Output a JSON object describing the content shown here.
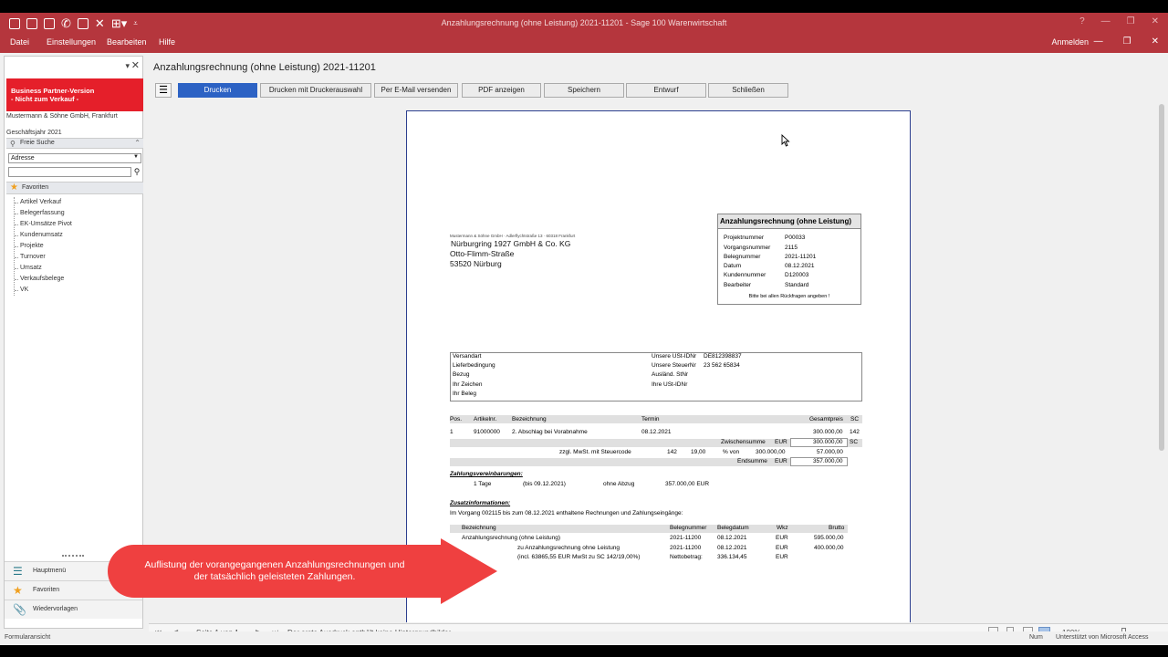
{
  "window": {
    "title": "Anzahlungsrechnung (ohne Leistung) 2021-11201 - Sage 100 Warenwirtschaft",
    "help": "?",
    "colors": {
      "titlebar": "#b5363d",
      "primary_button": "#2c62c4",
      "banner": "#e51f2a",
      "callout": "#ef4040"
    }
  },
  "menu": {
    "items": [
      "Datei",
      "Einstellungen",
      "Bearbeiten",
      "Hilfe"
    ],
    "login": "Anmelden"
  },
  "sidebar": {
    "banner_line1": "Business Partner-Version",
    "banner_line2": "- Nicht zum Verkauf -",
    "company": "Mustermann & Söhne GmbH, Frankfurt",
    "fiscal_year": "Geschäftsjahr 2021",
    "search_label": "Freie Suche",
    "search_select": "Adresse",
    "favorites_label": "Favoriten",
    "tree": [
      "Artikel Verkauf",
      "Belegerfassung",
      "EK-Umsätze Pivot",
      "Kundenumsatz",
      "Projekte",
      "Turnover",
      "Umsatz",
      "Verkaufsbelege",
      "VK"
    ],
    "nav": [
      "Hauptmenü",
      "Favoriten",
      "Wiedervorlagen"
    ]
  },
  "main": {
    "title": "Anzahlungsrechnung (ohne Leistung) 2021-11201",
    "toolbar": [
      "Drucken",
      "Drucken mit Druckerauswahl",
      "Per E-Mail versenden",
      "PDF anzeigen",
      "Speichern",
      "Entwurf",
      "Schließen"
    ]
  },
  "document": {
    "sender_line": "Mustermann & Söhne GmbH · Adlerflychtstraße 13 · 60318 Frankfurt",
    "address": [
      "Nürburgring 1927 GmbH & Co. KG",
      "Otto-Flimm-Straße",
      "53520 Nürburg"
    ],
    "info_title": "Anzahlungsrechnung (ohne Leistung)",
    "info_rows": [
      {
        "label": "Projektnummer",
        "value": "P00033"
      },
      {
        "label": "Vorgangsnummer",
        "value": "2115"
      },
      {
        "label": "Belegnummer",
        "value": "2021-11201"
      },
      {
        "label": "Datum",
        "value": "08.12.2021"
      },
      {
        "label": "Kundennummer",
        "value": "D120003"
      },
      {
        "label": "Bearbeiter",
        "value": "Standard"
      }
    ],
    "info_note": "Bitte bei allen Rückfragen angeben !",
    "ship_left": [
      "Versandart",
      "Lieferbedingung",
      "Bezug",
      "Ihr Zeichen",
      "Ihr Beleg"
    ],
    "ship_right": [
      {
        "label": "Unsere USt-IDNr",
        "value": "DE812398837"
      },
      {
        "label": "Unsere SteuerNr",
        "value": "23 562 65834"
      },
      {
        "label": "Ausländ. StNr",
        "value": ""
      },
      {
        "label": "Ihre USt-IDNr",
        "value": ""
      }
    ],
    "pos_header": {
      "pos": "Pos.",
      "artikel": "Artikelnr.",
      "bez": "Bezeichnung",
      "termin": "Termin",
      "gesamt": "Gesamtpreis",
      "sc": "SC"
    },
    "pos_row": {
      "pos": "1",
      "artikel": "91000000",
      "bez": "2. Abschlag bei Vorabnahme",
      "termin": "08.12.2021",
      "gesamt": "300.000,00",
      "sc": "142"
    },
    "zwischensumme_label": "Zwischensumme",
    "currency": "EUR",
    "zwischensumme": "300.000,00",
    "sc_label": "SC",
    "mwst_label": "zzgl. MwSt. mit Steuercode",
    "mwst_code": "142",
    "mwst_rate": "19,00",
    "mwst_of": "% von",
    "mwst_base": "300.000,00",
    "mwst_amount": "57.000,00",
    "endsumme_label": "Endsumme",
    "endsumme": "357.000,00",
    "zahlung_heading": "Zahlungsvereinbarungen:",
    "zahlung_row": {
      "tage": "1 Tage",
      "bis": "(bis 09.12.2021)",
      "abzug": "ohne Abzug",
      "betrag": "357.000,00 EUR"
    },
    "zusatz_heading": "Zusatzinformationen:",
    "zusatz_text": "Im Vorgang 002115 bis zum 08.12.2021 enthaltene Rechnungen und Zahlungseingänge:",
    "prev_header": {
      "bez": "Bezeichnung",
      "nr": "Belegnummer",
      "datum": "Belegdatum",
      "wkz": "Wkz",
      "brutto": "Brutto"
    },
    "prev_rows": [
      {
        "bez": "Anzahlungsrechnung (ohne Leistung)",
        "nr": "2021-11200",
        "datum": "08.12.2021",
        "wkz": "EUR",
        "brutto": "595.000,00"
      },
      {
        "bez": "zu Anzahlungsrechnung ohne Leistung",
        "nr": "2021-11200",
        "datum": "08.12.2021",
        "wkz": "EUR",
        "brutto": "400.000,00"
      }
    ],
    "prev_note": "(incl. 63865,55 EUR MwSt zu SC 142/19,00%)",
    "netto_label": "Nettobetrag:",
    "netto_value": "336.134,45",
    "netto_currency": "EUR"
  },
  "callout": {
    "line1": "Auflistung der vorangegangenen Anzahlungsrechnungen und",
    "line2": "der tatsächlich geleisteten Zahlungen."
  },
  "pager": {
    "page_label": "Seite 1 von 1",
    "message": "Der erste Ausdruck enthält keine Hintergrundbilder",
    "zoom": "100%"
  },
  "status": {
    "left": "Formularansicht",
    "num": "Num",
    "right": "Unterstützt von Microsoft Access"
  }
}
